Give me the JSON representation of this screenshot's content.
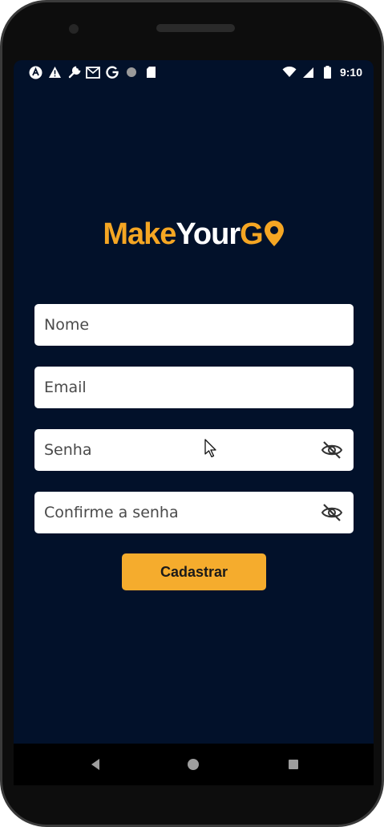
{
  "status_bar": {
    "time": "9:10",
    "left_icons": [
      "accessibility-icon",
      "warning-icon",
      "wrench-icon",
      "gmail-icon",
      "google-icon",
      "dot-icon",
      "sd-card-icon"
    ],
    "right_icons": [
      "wifi-icon",
      "signal-icon",
      "battery-icon"
    ]
  },
  "logo": {
    "part1": "Make",
    "part2": "Your",
    "part3": "G"
  },
  "form": {
    "name_placeholder": "Nome",
    "email_placeholder": "Email",
    "password_placeholder": "Senha",
    "confirm_placeholder": "Confirme a senha",
    "submit_label": "Cadastrar"
  },
  "colors": {
    "background": "#02112a",
    "accent": "#f5ac2d",
    "logo_white": "#ffffff"
  }
}
